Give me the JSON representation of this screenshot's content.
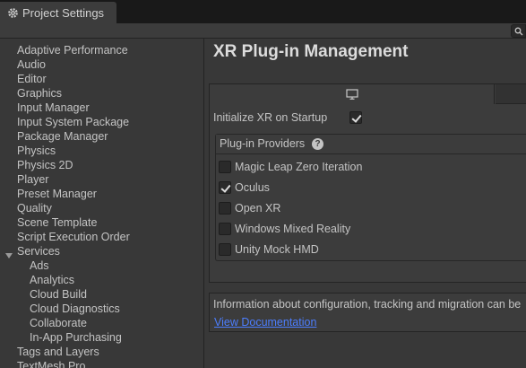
{
  "window": {
    "tab_title": "Project Settings"
  },
  "sidebar": {
    "items": [
      {
        "label": "Adaptive Performance"
      },
      {
        "label": "Audio"
      },
      {
        "label": "Editor"
      },
      {
        "label": "Graphics"
      },
      {
        "label": "Input Manager"
      },
      {
        "label": "Input System Package"
      },
      {
        "label": "Package Manager"
      },
      {
        "label": "Physics"
      },
      {
        "label": "Physics 2D"
      },
      {
        "label": "Player"
      },
      {
        "label": "Preset Manager"
      },
      {
        "label": "Quality"
      },
      {
        "label": "Scene Template"
      },
      {
        "label": "Script Execution Order"
      },
      {
        "label": "Services",
        "expanded": true
      },
      {
        "label": "Ads",
        "child": true
      },
      {
        "label": "Analytics",
        "child": true
      },
      {
        "label": "Cloud Build",
        "child": true
      },
      {
        "label": "Cloud Diagnostics",
        "child": true
      },
      {
        "label": "Collaborate",
        "child": true
      },
      {
        "label": "In-App Purchasing",
        "child": true
      },
      {
        "label": "Tags and Layers"
      },
      {
        "label": "TextMesh Pro"
      }
    ]
  },
  "main": {
    "title": "XR Plug-in Management",
    "platform_tab_icon": "monitor-icon",
    "init_xr_label": "Initialize XR on Startup",
    "init_xr_checked": true,
    "providers_header": "Plug-in Providers",
    "providers": [
      {
        "label": "Magic Leap Zero Iteration",
        "checked": false
      },
      {
        "label": "Oculus",
        "checked": true
      },
      {
        "label": "Open XR",
        "checked": false
      },
      {
        "label": "Windows Mixed Reality",
        "checked": false
      },
      {
        "label": "Unity Mock HMD",
        "checked": false
      }
    ],
    "info_text": "Information about configuration, tracking and migration can be",
    "info_link": "View Documentation"
  },
  "colors": {
    "link": "#4c7eff",
    "background": "#383838",
    "tabbar": "#191919"
  }
}
